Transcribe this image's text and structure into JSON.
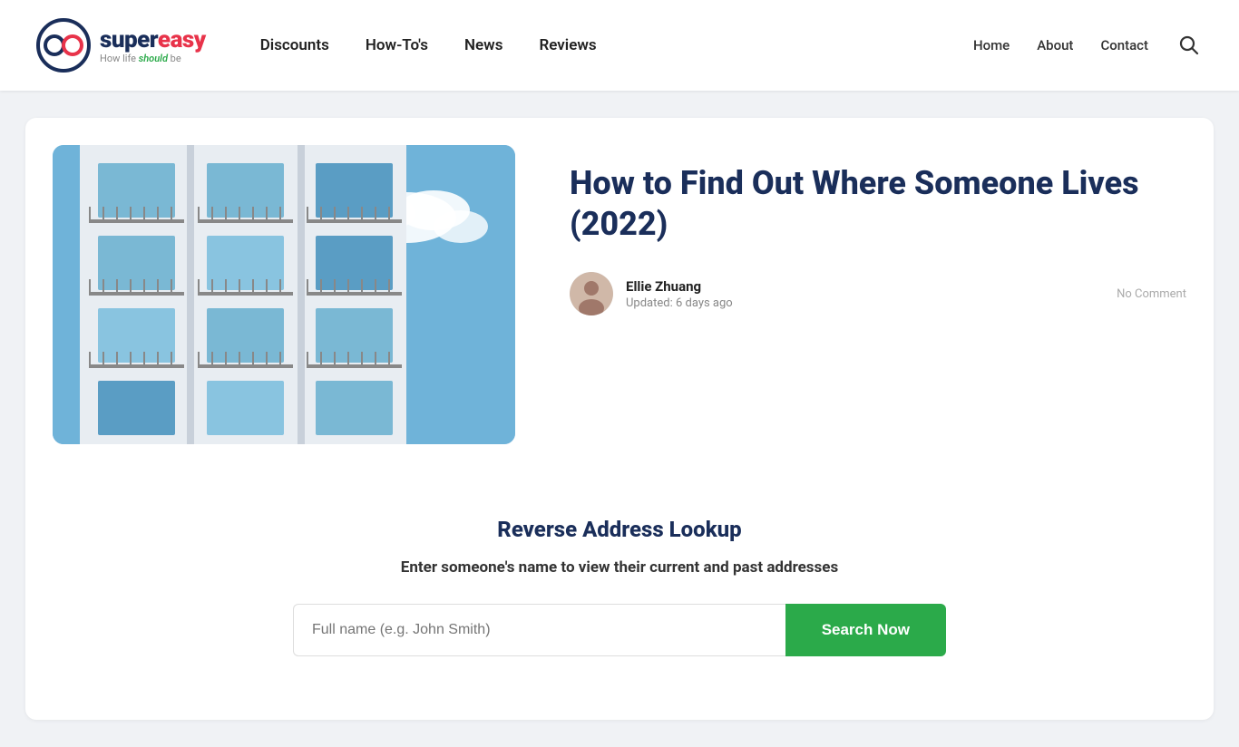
{
  "header": {
    "logo": {
      "super": "super",
      "easy": "easy",
      "tagline_prefix": "How life ",
      "tagline_highlight": "should",
      "tagline_suffix": " be"
    },
    "nav_links": [
      {
        "label": "Discounts",
        "id": "nav-discounts"
      },
      {
        "label": "How-To's",
        "id": "nav-howtos"
      },
      {
        "label": "News",
        "id": "nav-news"
      },
      {
        "label": "Reviews",
        "id": "nav-reviews"
      }
    ],
    "right_links": [
      {
        "label": "Home",
        "id": "nav-home"
      },
      {
        "label": "About",
        "id": "nav-about"
      },
      {
        "label": "Contact",
        "id": "nav-contact"
      }
    ]
  },
  "article": {
    "title": "How to Find Out Where Someone Lives (2022)",
    "author": {
      "name": "Ellie Zhuang",
      "updated": "Updated: 6 days ago"
    },
    "no_comment": "No Comment"
  },
  "lookup": {
    "title": "Reverse Address Lookup",
    "subtitle": "Enter someone's name to view their current and past addresses",
    "input_placeholder": "Full name (e.g. John Smith)",
    "button_label": "Search Now"
  }
}
